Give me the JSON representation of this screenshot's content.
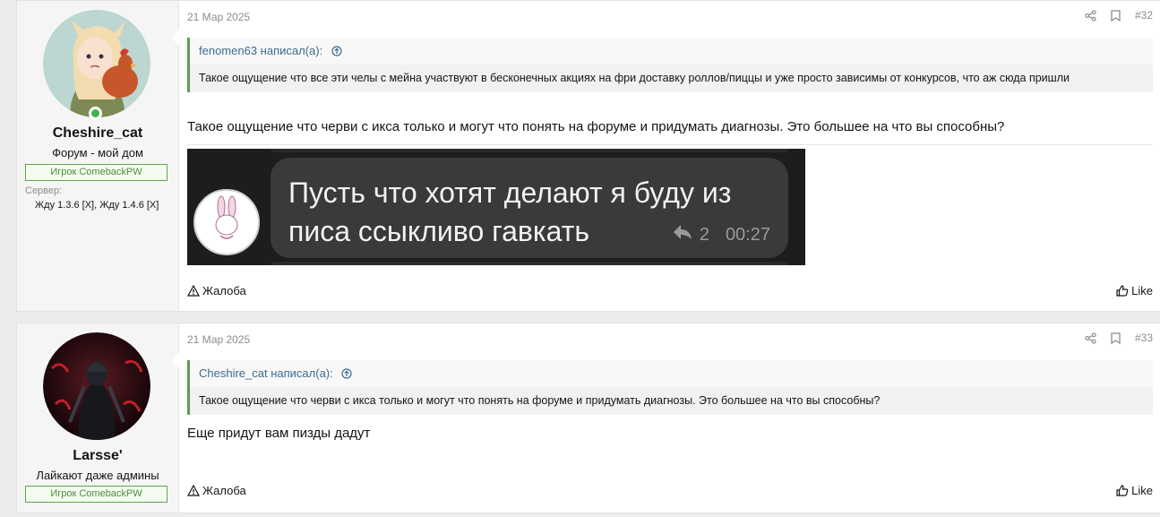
{
  "posts": [
    {
      "username": "Cheshire_cat",
      "user_title": "Форум - мой дом",
      "banner": "Игрок ComebackPW",
      "extra_label": "Сервер:",
      "extra_value": "Жду 1.3.6 [X], Жду 1.4.6 [X]",
      "online": true,
      "date": "21 Мар 2025",
      "post_number": "#32",
      "quote": {
        "author": "fenomen63 написал(а):",
        "text": "Такое ощущение что все эти челы с мейна участвуют в бесконечных акциях на фри доставку роллов/пиццы и уже просто зависимы от конкурсов, что аж сюда пришли"
      },
      "message": "Такое ощущение что черви с икса только и могут что понять на форуме и придумать диагнозы. Это большее на что вы способны?",
      "embed": {
        "text": "Пусть что хотят делают я буду из писа ссыкливо гавкать",
        "replies": "2",
        "time": "00:27"
      },
      "report_label": "Жалоба",
      "like_label": "Like"
    },
    {
      "username": "Larsse'",
      "user_title": "Лайкают даже админы",
      "banner": "Игрок ComebackPW",
      "date": "21 Мар 2025",
      "post_number": "#33",
      "quote": {
        "author": "Cheshire_cat написал(а):",
        "text": "Такое ощущение что черви с икса только и могут что понять на форуме и придумать диагнозы. Это большее на что вы способны?"
      },
      "message": "Еще придут вам пизды дадут",
      "report_label": "Жалоба",
      "like_label": "Like"
    }
  ],
  "colors": {
    "accent_green": "#5aa04e",
    "link_blue": "#3d6b8f",
    "online": "#3fb34f"
  }
}
